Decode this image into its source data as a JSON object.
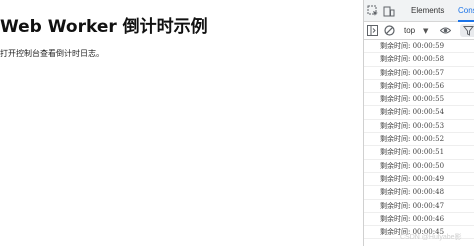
{
  "page": {
    "title": "Web Worker 倒计时示例",
    "description": "打开控制台查看倒计时日志。"
  },
  "devtools": {
    "tabs": [
      {
        "label": "Elements",
        "active": false
      },
      {
        "label": "Cons",
        "active": true
      }
    ],
    "context_selector": "top",
    "log_entries": [
      "剩余时间: 00:00:59",
      "剩余时间: 00:00:58",
      "剩余时间: 00:00:57",
      "剩余时间: 00:00:56",
      "剩余时间: 00:00:55",
      "剩余时间: 00:00:54",
      "剩余时间: 00:00:53",
      "剩余时间: 00:00:52",
      "剩余时间: 00:00:51",
      "剩余时间: 00:00:50",
      "剩余时间: 00:00:49",
      "剩余时间: 00:00:48",
      "剩余时间: 00:00:47",
      "剩余时间: 00:00:46",
      "剩余时间: 00:00:45"
    ]
  },
  "watermark": "CSDN @Hulyabe影"
}
